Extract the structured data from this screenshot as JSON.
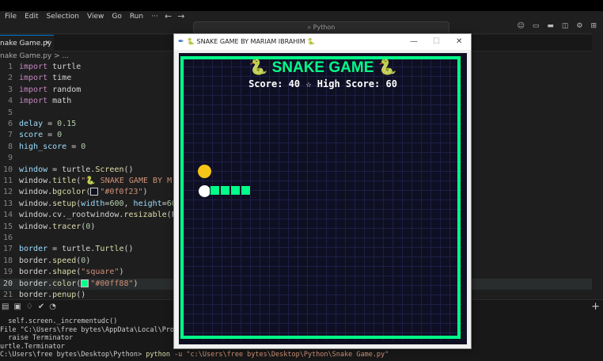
{
  "menu": [
    "File",
    "Edit",
    "Selection",
    "View",
    "Go",
    "Run",
    "···"
  ],
  "search_placeholder": "Python",
  "tab": {
    "label": "nake Game.py",
    "close": "✕"
  },
  "breadcrumb": "nake Game.py > ...",
  "code_lines": [
    {
      "n": "1",
      "html": "<span class='kw'>import</span> turtle"
    },
    {
      "n": "2",
      "html": "<span class='kw'>import</span> time"
    },
    {
      "n": "3",
      "html": "<span class='kw'>import</span> random"
    },
    {
      "n": "4",
      "html": "<span class='kw'>import</span> math"
    },
    {
      "n": "5",
      "html": ""
    },
    {
      "n": "6",
      "html": "<span class='var'>delay</span> = <span class='num'>0.15</span>"
    },
    {
      "n": "7",
      "html": "<span class='var'>score</span> = <span class='num'>0</span>"
    },
    {
      "n": "8",
      "html": "<span class='var'>high_score</span> = <span class='num'>0</span>"
    },
    {
      "n": "9",
      "html": ""
    },
    {
      "n": "10",
      "html": "<span class='var'>window</span> = turtle.<span class='fn'>Screen</span>()"
    },
    {
      "n": "11",
      "html": "window.<span class='fn'>title</span>(<span class='str'>\"🐍 SNAKE GAME BY M</span>"
    },
    {
      "n": "12",
      "html": "window.<span class='fn'>bgcolor</span>(<span class='swatch' style='background:#0f0f23'></span><span class='str'>\"#0f0f23\"</span>)"
    },
    {
      "n": "13",
      "html": "window.<span class='fn'>setup</span>(<span class='var'>width</span>=<span class='num'>600</span>, <span class='var'>height</span>=<span class='num'>60</span>"
    },
    {
      "n": "14",
      "html": "window.cv._rootwindow.<span class='fn'>resizable</span>(F"
    },
    {
      "n": "15",
      "html": "window.<span class='fn'>tracer</span>(<span class='num'>0</span>)"
    },
    {
      "n": "16",
      "html": ""
    },
    {
      "n": "17",
      "html": "<span class='var'>border</span> = turtle.<span class='fn'>Turtle</span>()"
    },
    {
      "n": "18",
      "html": "border.<span class='fn'>speed</span>(<span class='num'>0</span>)"
    },
    {
      "n": "19",
      "html": "border.<span class='fn'>shape</span>(<span class='str'>\"square\"</span>)"
    },
    {
      "n": "20",
      "html": "border.<span class='fn'>color</span>(<span class='swatch' style='background:#00ff88'></span><span class='str'>\"#00ff88\"</span>)"
    },
    {
      "n": "21",
      "html": "border.<span class='fn'>penup</span>()"
    }
  ],
  "active_line": 19,
  "terminal": [
    "  self.screen._incrementudc()",
    "File \"C:\\Users\\free bytes\\AppData\\Local\\Programs\\Py",
    "  raise Terminator",
    "urtle.Terminator",
    "C:\\Users\\free bytes\\Desktop\\Python> python -u \"c:\\Users\\free bytes\\Desktop\\Python\\Snake Game.py\""
  ],
  "turtle_window": {
    "title": "SNAKE GAME BY MARIAM IBRAHIM",
    "minimize": "—",
    "maximize": "☐",
    "close": "✕"
  },
  "game": {
    "title": "🐍 SNAKE GAME 🐍",
    "score_line": "Score: 40 ☆ High Score: 60",
    "colors": {
      "background": "#0f0f23",
      "border": "#00ff88",
      "snake": "#00ff88",
      "food": "#f5c518",
      "head": "#ffffff"
    }
  }
}
